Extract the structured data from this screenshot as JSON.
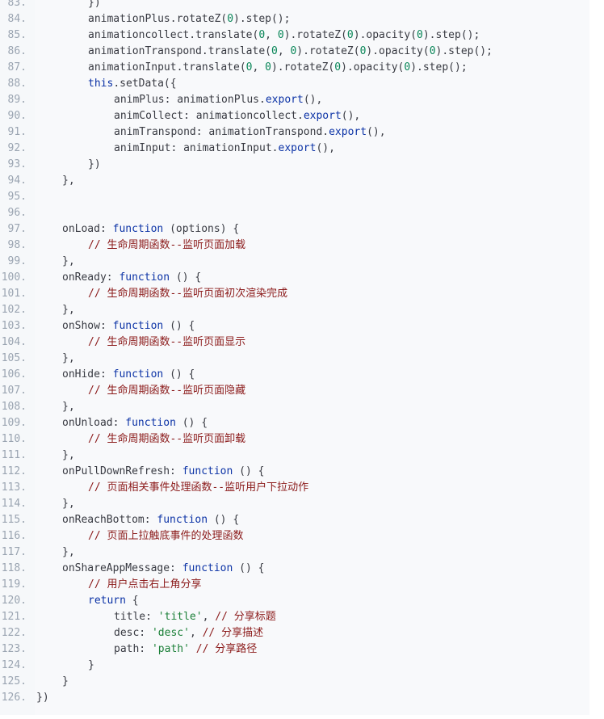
{
  "code_lines": [
    {
      "n": "83.",
      "indent": 2,
      "tokens": [
        [
          "punct",
          "})"
        ]
      ]
    },
    {
      "n": "84.",
      "indent": 2,
      "tokens": [
        [
          "plain",
          "animationPlus.rotateZ("
        ],
        [
          "num",
          "0"
        ],
        [
          "plain",
          ").step();"
        ]
      ]
    },
    {
      "n": "85.",
      "indent": 2,
      "tokens": [
        [
          "plain",
          "animationcollect.translate("
        ],
        [
          "num",
          "0"
        ],
        [
          "plain",
          ", "
        ],
        [
          "num",
          "0"
        ],
        [
          "plain",
          ").rotateZ("
        ],
        [
          "num",
          "0"
        ],
        [
          "plain",
          ").opacity("
        ],
        [
          "num",
          "0"
        ],
        [
          "plain",
          ").step();"
        ]
      ]
    },
    {
      "n": "86.",
      "indent": 2,
      "tokens": [
        [
          "plain",
          "animationTranspond.translate("
        ],
        [
          "num",
          "0"
        ],
        [
          "plain",
          ", "
        ],
        [
          "num",
          "0"
        ],
        [
          "plain",
          ").rotateZ("
        ],
        [
          "num",
          "0"
        ],
        [
          "plain",
          ").opacity("
        ],
        [
          "num",
          "0"
        ],
        [
          "plain",
          ").step();"
        ]
      ]
    },
    {
      "n": "87.",
      "indent": 2,
      "tokens": [
        [
          "plain",
          "animationInput.translate("
        ],
        [
          "num",
          "0"
        ],
        [
          "plain",
          ", "
        ],
        [
          "num",
          "0"
        ],
        [
          "plain",
          ").rotateZ("
        ],
        [
          "num",
          "0"
        ],
        [
          "plain",
          ").opacity("
        ],
        [
          "num",
          "0"
        ],
        [
          "plain",
          ").step();"
        ]
      ]
    },
    {
      "n": "88.",
      "indent": 2,
      "tokens": [
        [
          "kw",
          "this"
        ],
        [
          "plain",
          ".setData({"
        ]
      ]
    },
    {
      "n": "89.",
      "indent": 3,
      "tokens": [
        [
          "plain",
          "animPlus: animationPlus."
        ],
        [
          "exp",
          "export"
        ],
        [
          "plain",
          "(),"
        ]
      ]
    },
    {
      "n": "90.",
      "indent": 3,
      "tokens": [
        [
          "plain",
          "animCollect: animationcollect."
        ],
        [
          "exp",
          "export"
        ],
        [
          "plain",
          "(),"
        ]
      ]
    },
    {
      "n": "91.",
      "indent": 3,
      "tokens": [
        [
          "plain",
          "animTranspond: animationTranspond."
        ],
        [
          "exp",
          "export"
        ],
        [
          "plain",
          "(),"
        ]
      ]
    },
    {
      "n": "92.",
      "indent": 3,
      "tokens": [
        [
          "plain",
          "animInput: animationInput."
        ],
        [
          "exp",
          "export"
        ],
        [
          "plain",
          "(),"
        ]
      ]
    },
    {
      "n": "93.",
      "indent": 2,
      "tokens": [
        [
          "punct",
          "})"
        ]
      ]
    },
    {
      "n": "94.",
      "indent": 1,
      "tokens": [
        [
          "punct",
          "},"
        ]
      ]
    },
    {
      "n": "95.",
      "indent": 0,
      "tokens": []
    },
    {
      "n": "96.",
      "indent": 0,
      "tokens": []
    },
    {
      "n": "97.",
      "indent": 1,
      "tokens": [
        [
          "plain",
          "onLoad: "
        ],
        [
          "kw",
          "function"
        ],
        [
          "plain",
          " (options) {"
        ]
      ]
    },
    {
      "n": "98.",
      "indent": 2,
      "tokens": [
        [
          "cm",
          "// 生命周期函数--监听页面加载"
        ]
      ]
    },
    {
      "n": "99.",
      "indent": 1,
      "tokens": [
        [
          "punct",
          "},"
        ]
      ]
    },
    {
      "n": "100.",
      "indent": 1,
      "tokens": [
        [
          "plain",
          "onReady: "
        ],
        [
          "kw",
          "function"
        ],
        [
          "plain",
          " () {"
        ]
      ]
    },
    {
      "n": "101.",
      "indent": 2,
      "tokens": [
        [
          "cm",
          "// 生命周期函数--监听页面初次渲染完成"
        ]
      ]
    },
    {
      "n": "102.",
      "indent": 1,
      "tokens": [
        [
          "punct",
          "},"
        ]
      ]
    },
    {
      "n": "103.",
      "indent": 1,
      "tokens": [
        [
          "plain",
          "onShow: "
        ],
        [
          "kw",
          "function"
        ],
        [
          "plain",
          " () {"
        ]
      ]
    },
    {
      "n": "104.",
      "indent": 2,
      "tokens": [
        [
          "cm",
          "// 生命周期函数--监听页面显示"
        ]
      ]
    },
    {
      "n": "105.",
      "indent": 1,
      "tokens": [
        [
          "punct",
          "},"
        ]
      ]
    },
    {
      "n": "106.",
      "indent": 1,
      "tokens": [
        [
          "plain",
          "onHide: "
        ],
        [
          "kw",
          "function"
        ],
        [
          "plain",
          " () {"
        ]
      ]
    },
    {
      "n": "107.",
      "indent": 2,
      "tokens": [
        [
          "cm",
          "// 生命周期函数--监听页面隐藏"
        ]
      ]
    },
    {
      "n": "108.",
      "indent": 1,
      "tokens": [
        [
          "punct",
          "},"
        ]
      ]
    },
    {
      "n": "109.",
      "indent": 1,
      "tokens": [
        [
          "plain",
          "onUnload: "
        ],
        [
          "kw",
          "function"
        ],
        [
          "plain",
          " () {"
        ]
      ]
    },
    {
      "n": "110.",
      "indent": 2,
      "tokens": [
        [
          "cm",
          "// 生命周期函数--监听页面卸载"
        ]
      ]
    },
    {
      "n": "111.",
      "indent": 1,
      "tokens": [
        [
          "punct",
          "},"
        ]
      ]
    },
    {
      "n": "112.",
      "indent": 1,
      "tokens": [
        [
          "plain",
          "onPullDownRefresh: "
        ],
        [
          "kw",
          "function"
        ],
        [
          "plain",
          " () {"
        ]
      ]
    },
    {
      "n": "113.",
      "indent": 2,
      "tokens": [
        [
          "cm",
          "// 页面相关事件处理函数--监听用户下拉动作"
        ]
      ]
    },
    {
      "n": "114.",
      "indent": 1,
      "tokens": [
        [
          "punct",
          "},"
        ]
      ]
    },
    {
      "n": "115.",
      "indent": 1,
      "tokens": [
        [
          "plain",
          "onReachBottom: "
        ],
        [
          "kw",
          "function"
        ],
        [
          "plain",
          " () {"
        ]
      ]
    },
    {
      "n": "116.",
      "indent": 2,
      "tokens": [
        [
          "cm",
          "// 页面上拉触底事件的处理函数"
        ]
      ]
    },
    {
      "n": "117.",
      "indent": 1,
      "tokens": [
        [
          "punct",
          "},"
        ]
      ]
    },
    {
      "n": "118.",
      "indent": 1,
      "tokens": [
        [
          "plain",
          "onShareAppMessage: "
        ],
        [
          "kw",
          "function"
        ],
        [
          "plain",
          " () {"
        ]
      ]
    },
    {
      "n": "119.",
      "indent": 2,
      "tokens": [
        [
          "cm",
          "// 用户点击右上角分享"
        ]
      ]
    },
    {
      "n": "120.",
      "indent": 2,
      "tokens": [
        [
          "kw",
          "return"
        ],
        [
          "plain",
          " {"
        ]
      ]
    },
    {
      "n": "121.",
      "indent": 3,
      "tokens": [
        [
          "plain",
          "title: "
        ],
        [
          "str",
          "'title'"
        ],
        [
          "plain",
          ", "
        ],
        [
          "cm",
          "// 分享标题"
        ]
      ]
    },
    {
      "n": "122.",
      "indent": 3,
      "tokens": [
        [
          "plain",
          "desc: "
        ],
        [
          "str",
          "'desc'"
        ],
        [
          "plain",
          ", "
        ],
        [
          "cm",
          "// 分享描述"
        ]
      ]
    },
    {
      "n": "123.",
      "indent": 3,
      "tokens": [
        [
          "plain",
          "path: "
        ],
        [
          "str",
          "'path'"
        ],
        [
          "plain",
          " "
        ],
        [
          "cm",
          "// 分享路径"
        ]
      ]
    },
    {
      "n": "124.",
      "indent": 2,
      "tokens": [
        [
          "punct",
          "}"
        ]
      ]
    },
    {
      "n": "125.",
      "indent": 1,
      "tokens": [
        [
          "punct",
          "}"
        ]
      ]
    },
    {
      "n": "126.",
      "indent": 0,
      "tokens": [
        [
          "punct",
          "})"
        ]
      ]
    }
  ],
  "colors": {
    "background": "#f8f9fb",
    "line_number": "#9aa4b1",
    "keyword": "#0c33a6",
    "number": "#098658",
    "string": "#1a7f37",
    "comment": "#8b1a1a"
  }
}
